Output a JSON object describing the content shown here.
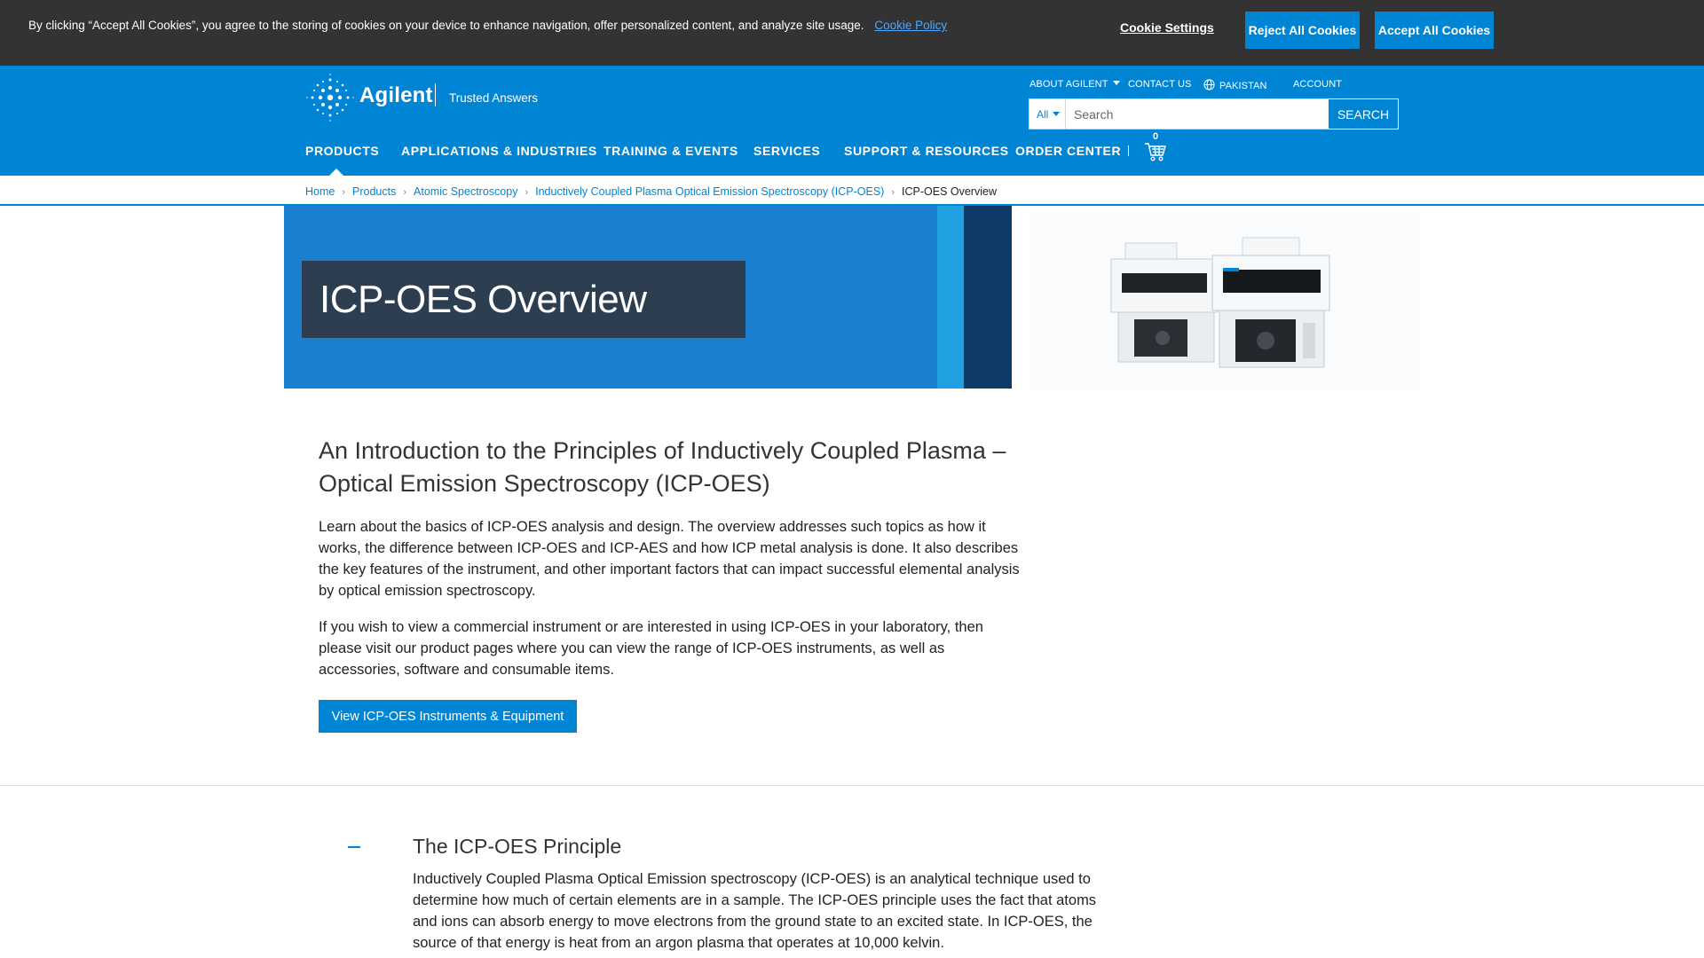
{
  "cookie_banner": {
    "text": "By clicking “Accept All Cookies”, you agree to the storing of cookies on your device to enhance navigation, offer personalized content, and analyze site usage.",
    "policy_link": "Cookie Policy",
    "settings_label": "Cookie Settings",
    "reject_label": "Reject All Cookies",
    "accept_label": "Accept All Cookies"
  },
  "header": {
    "brand": "Agilent",
    "tagline": "Trusted Answers",
    "utility": {
      "about": "ABOUT AGILENT",
      "contact": "CONTACT US",
      "country": "PAKISTAN",
      "account": "ACCOUNT"
    },
    "search": {
      "scope": "All",
      "placeholder": "Search",
      "button": "SEARCH"
    },
    "nav": [
      "PRODUCTS",
      "APPLICATIONS & INDUSTRIES",
      "TRAINING & EVENTS",
      "SERVICES",
      "SUPPORT & RESOURCES",
      "ORDER CENTER"
    ],
    "cart_count": "0",
    "colors": {
      "brand_blue": "#0085d5",
      "hero_blue": "#1a7fcf",
      "title_box": "#2c3e50"
    }
  },
  "breadcrumb": {
    "items": [
      "Home",
      "Products",
      "Atomic Spectroscopy",
      "Inductively Coupled Plasma Optical Emission Spectroscopy (ICP-OES)"
    ],
    "current": "ICP-OES Overview"
  },
  "hero": {
    "title": "ICP-OES Overview"
  },
  "main": {
    "intro_heading": "An Introduction to the Principles of Inductively Coupled Plasma – Optical Emission Spectroscopy (ICP-OES)",
    "paragraph_1": "Learn about the basics of ICP-OES analysis and design. The overview addresses such topics as how it works, the difference between ICP-OES and ICP-AES and how ICP metal analysis is done. It also describes the key features of the instrument, and other important factors that can impact successful elemental analysis by optical emission spectroscopy.",
    "paragraph_2": "If you wish to view a commercial instrument or are interested in using ICP-OES in your laboratory, then please visit our product pages where you can view the range of ICP-OES instruments, as well as accessories, software and consumable items.",
    "cta_label": "View ICP-OES Instruments & Equipment"
  },
  "accordion": {
    "heading": "The ICP-OES Principle",
    "body": "Inductively Coupled Plasma Optical Emission spectroscopy (ICP-OES) is an analytical technique used to determine how much of certain elements are in a sample. The ICP-OES principle uses the fact that atoms and ions can absorb energy to move electrons from the ground state to an excited state. In ICP-OES, the source of that energy is heat from an argon plasma that operates at 10,000 kelvin."
  }
}
